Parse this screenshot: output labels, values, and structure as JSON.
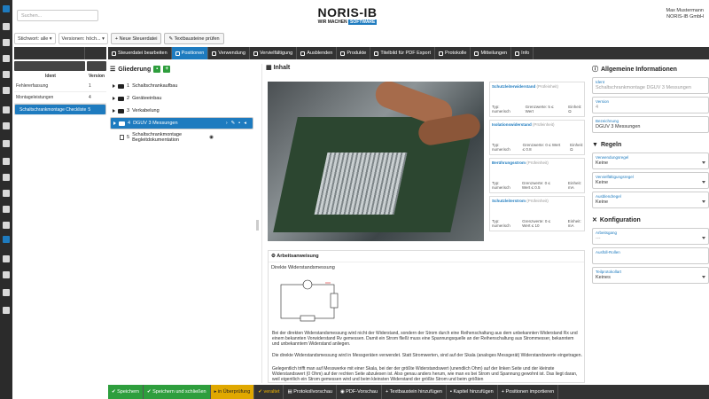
{
  "search": {
    "placeholder": "Suchen..."
  },
  "logo": {
    "name": "NORIS-IB",
    "tagline_left": "WIR MACHEN",
    "tagline_right": "SOFTWARE"
  },
  "user": {
    "name": "Max Mustermann",
    "company": "NORIS-IB GmbH"
  },
  "filters": {
    "stichwort_label": "Stichwort:",
    "stichwort_value": "alle",
    "versionen_label": "Versionen:",
    "versionen_value": "höch...",
    "new_button": "Neue Steuerdatei",
    "check_button": "Textbausteine prüfen"
  },
  "tabs": [
    {
      "label": "Steuerdatei bearbeiten"
    },
    {
      "label": "Positionen"
    },
    {
      "label": "Verwendung"
    },
    {
      "label": "Vervielfältigung"
    },
    {
      "label": "Ausblenden"
    },
    {
      "label": "Produkte"
    },
    {
      "label": "Titelbild für PDF Export"
    },
    {
      "label": "Protokolle"
    },
    {
      "label": "Mitteilungen"
    },
    {
      "label": "Info"
    }
  ],
  "list": {
    "col_ident": "Ident",
    "col_version": "Version",
    "rows": [
      {
        "ident": "Fehlererfassung",
        "version": "1"
      },
      {
        "ident": "Montageleistungen",
        "version": "4"
      },
      {
        "ident": "Schaltschrankmontage Checkliste",
        "version": "5"
      }
    ]
  },
  "tree": {
    "title": "Gliederung",
    "items": [
      {
        "num": "1",
        "label": "Schaltschrankaufbau"
      },
      {
        "num": "2",
        "label": "Geräteeinbau"
      },
      {
        "num": "3",
        "label": "Verkabelung"
      },
      {
        "num": "4",
        "label": "DGUV 3 Messungen"
      },
      {
        "num": "5",
        "label": "Schaltschrankmontage Begleitdokumentation"
      }
    ]
  },
  "content": {
    "title": "Inhalt",
    "cards": [
      {
        "title": "Schutzleiterwiderstand",
        "tag": "(Prüfeinheit)",
        "typ": "Typ: numerisch",
        "grenz": "Grenzwerte: 5 ≤ Wert",
        "einheit": "Einheit: Ω"
      },
      {
        "title": "Isolationswiderstand",
        "tag": "(Prüfeinheit)",
        "typ": "Typ: numerisch",
        "grenz": "Grenzwerte: 0 ≤ Wert ≤ 0.8",
        "einheit": "Einheit: Ω"
      },
      {
        "title": "Berührungsstrom",
        "tag": "(Prüfeinheit)",
        "typ": "Typ: numerisch",
        "grenz": "Grenzwerte: 0 ≤ Wert ≤ 0.5",
        "einheit": "Einheit: mA"
      },
      {
        "title": "Schutzleiterstrom",
        "tag": "(Prüfeinheit)",
        "typ": "Typ: numerisch",
        "grenz": "Grenzwerte: 0 ≤ Wert ≤ 10",
        "einheit": "Einheit: mA"
      }
    ],
    "anweisung_title": "Arbeitsanweisung",
    "anweisung_sub": "Direkte Widerstandsmessung",
    "para1": "Bei der direkten Widerstandsmessung wird nicht der Widerstand, sondern der Strom durch eine Reihenschaltung aus dem unbekannten Widerstand Rx und einem bekannten Vorwiderstand Rv gemessen. Damit ein Strom fließt muss eine Spannungsquelle an der Reihenschaltung aus Strommesser, bekanntem und unbekanntem Widerstand anliegen.",
    "para2": "Die direkte Widerstandsmessung wird in Messgeräten verwendet. Statt Stromwerten, sind auf der Skala (analoges Messgerät) Widerstandswerte eingetragen.",
    "para3": "Gelegentlich trifft man auf Messwerke mit einer Skala, bei der der größte Widerstandswert (unendlich Ohm) auf der linken Seite und der kleinste Widerstandswert (0 Ohm) auf der rechten Seite abzulesen ist. Also genau anders herum, wie man es bei Strom und Spannung gewohnt ist. Das liegt daran, weil eigentlich ein Strom gemessen wird und beim kleinsten Widerstand der größte Strom und beim größten"
  },
  "info": {
    "title": "Allgemeine Informationen",
    "ident_label": "Ident",
    "ident_value": "Schaltschrankmontage DGUV 3 Messungen",
    "version_label": "Version",
    "version_value": "4",
    "bez_label": "Bezeichnung",
    "bez_value": "DGUV 3 Messungen"
  },
  "rules": {
    "title": "Regeln",
    "verw_label": "Verwendungsregel",
    "verw_value": "Keine",
    "verv_label": "Vervielfältigungsregel",
    "verv_value": "Keine",
    "ausb_label": "Ausblendregel",
    "ausb_value": "Keine"
  },
  "config": {
    "title": "Konfiguration",
    "arb_label": "Arbeitsgang",
    "arb_value": "---",
    "ausf_label": "Ausfüll-Rollen",
    "teil_label": "Teilprotokollart",
    "teil_value": "Keines"
  },
  "bottom": [
    {
      "label": "Speichern"
    },
    {
      "label": "Speichern und schließen"
    },
    {
      "label": "in Überprüfung"
    },
    {
      "label": "veraltet"
    },
    {
      "label": "Protokollvorschau"
    },
    {
      "label": "PDF-Vorschau"
    },
    {
      "label": "Textbaustein hinzufügen"
    },
    {
      "label": "Kapitel hinzufügen"
    },
    {
      "label": "Positionen importieren"
    }
  ]
}
